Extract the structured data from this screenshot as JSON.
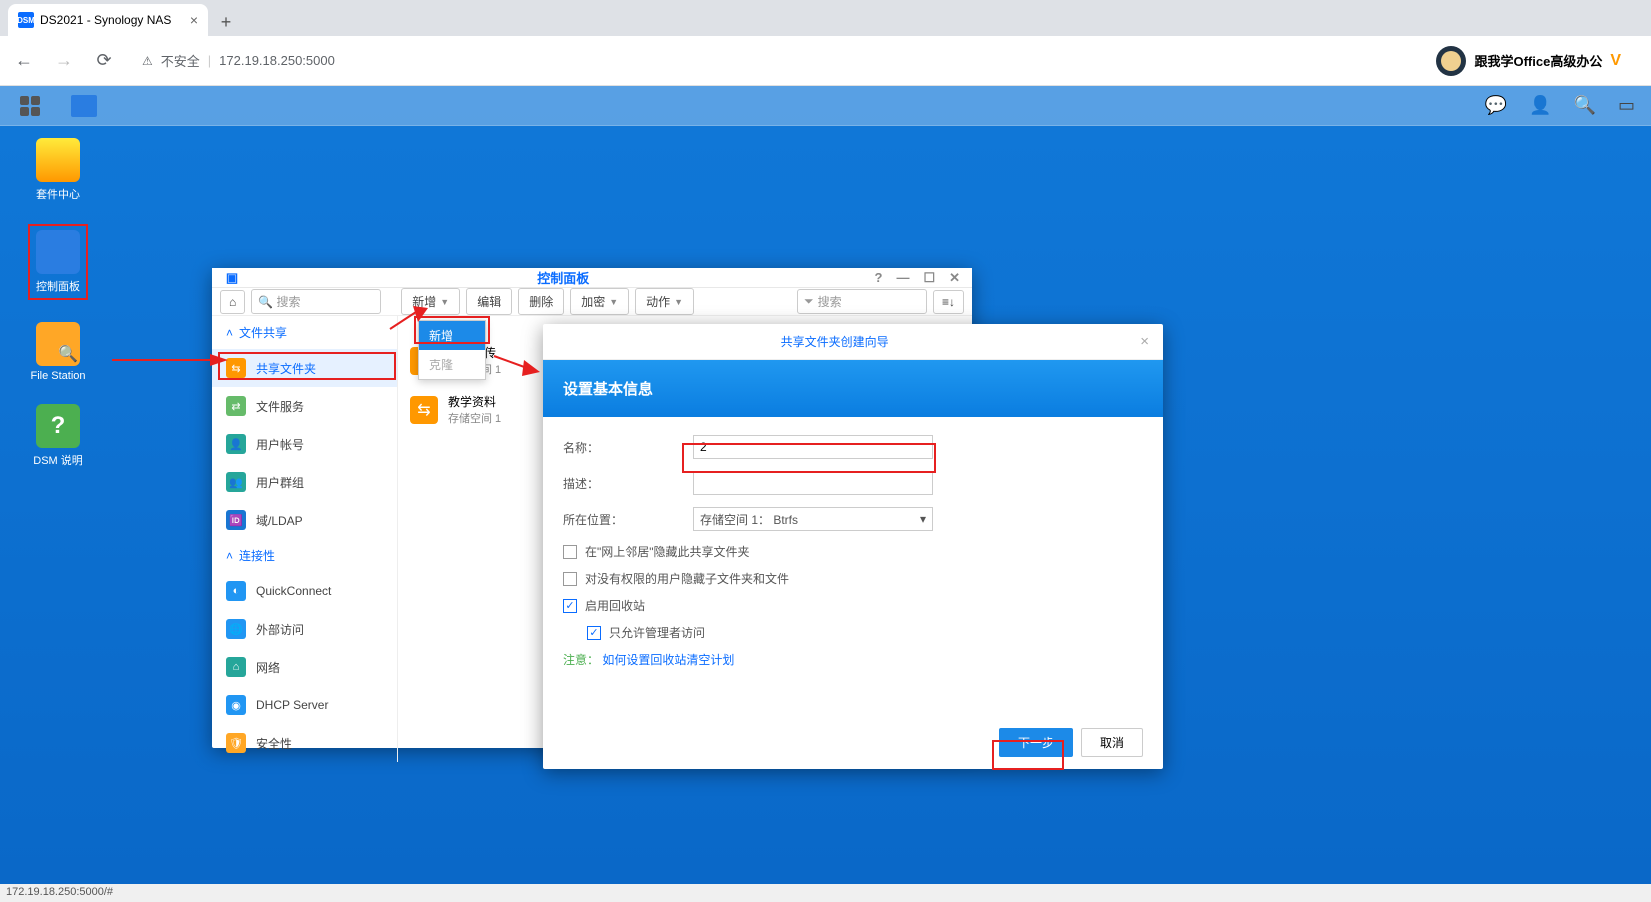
{
  "browser": {
    "tab_title": "DS2021 - Synology NAS",
    "url_warning": "不安全",
    "url": "172.19.18.250:5000",
    "profile_name": "跟我学Office高级办公",
    "status_bar": "172.19.18.250:5000/#"
  },
  "desktop_icons": {
    "pkg_center": "套件中心",
    "control_panel": "控制面板",
    "file_station": "File Station",
    "dsm_help": "DSM 说明"
  },
  "control_window": {
    "title": "控制面板",
    "home": "⌂",
    "search_placeholder": "搜索",
    "toolbar": {
      "create": "新增",
      "edit": "编辑",
      "delete": "删除",
      "encrypt": "加密",
      "action": "动作",
      "filter_placeholder": "搜索"
    },
    "sidebar": {
      "cat_share": "文件共享",
      "shared_folder": "共享文件夹",
      "file_service": "文件服务",
      "user": "用户帐号",
      "group": "用户群组",
      "domain": "域/LDAP",
      "cat_conn": "连接性",
      "quickconnect": "QuickConnect",
      "external": "外部访问",
      "network": "网络",
      "dhcp": "DHCP Server",
      "security": "安全性"
    },
    "shares": [
      {
        "name": "作业上传",
        "sub": "存储空间 1"
      },
      {
        "name": "教学资料",
        "sub": "存储空间 1"
      }
    ],
    "dropdown": {
      "create": "新增",
      "clone": "克隆"
    }
  },
  "wizard": {
    "title": "共享文件夹创建向导",
    "header": "设置基本信息",
    "labels": {
      "name": "名称：",
      "desc": "描述：",
      "location": "所在位置："
    },
    "values": {
      "name": "2",
      "location": "存储空间 1： Btrfs"
    },
    "checks": {
      "hide_network": "在\"网上邻居\"隐藏此共享文件夹",
      "hide_noperm": "对没有权限的用户隐藏子文件夹和文件",
      "recycle": "启用回收站",
      "admin_only": "只允许管理者访问"
    },
    "note_label": "注意：",
    "note_link": "如何设置回收站清空计划",
    "next": "下一步",
    "cancel": "取消"
  }
}
